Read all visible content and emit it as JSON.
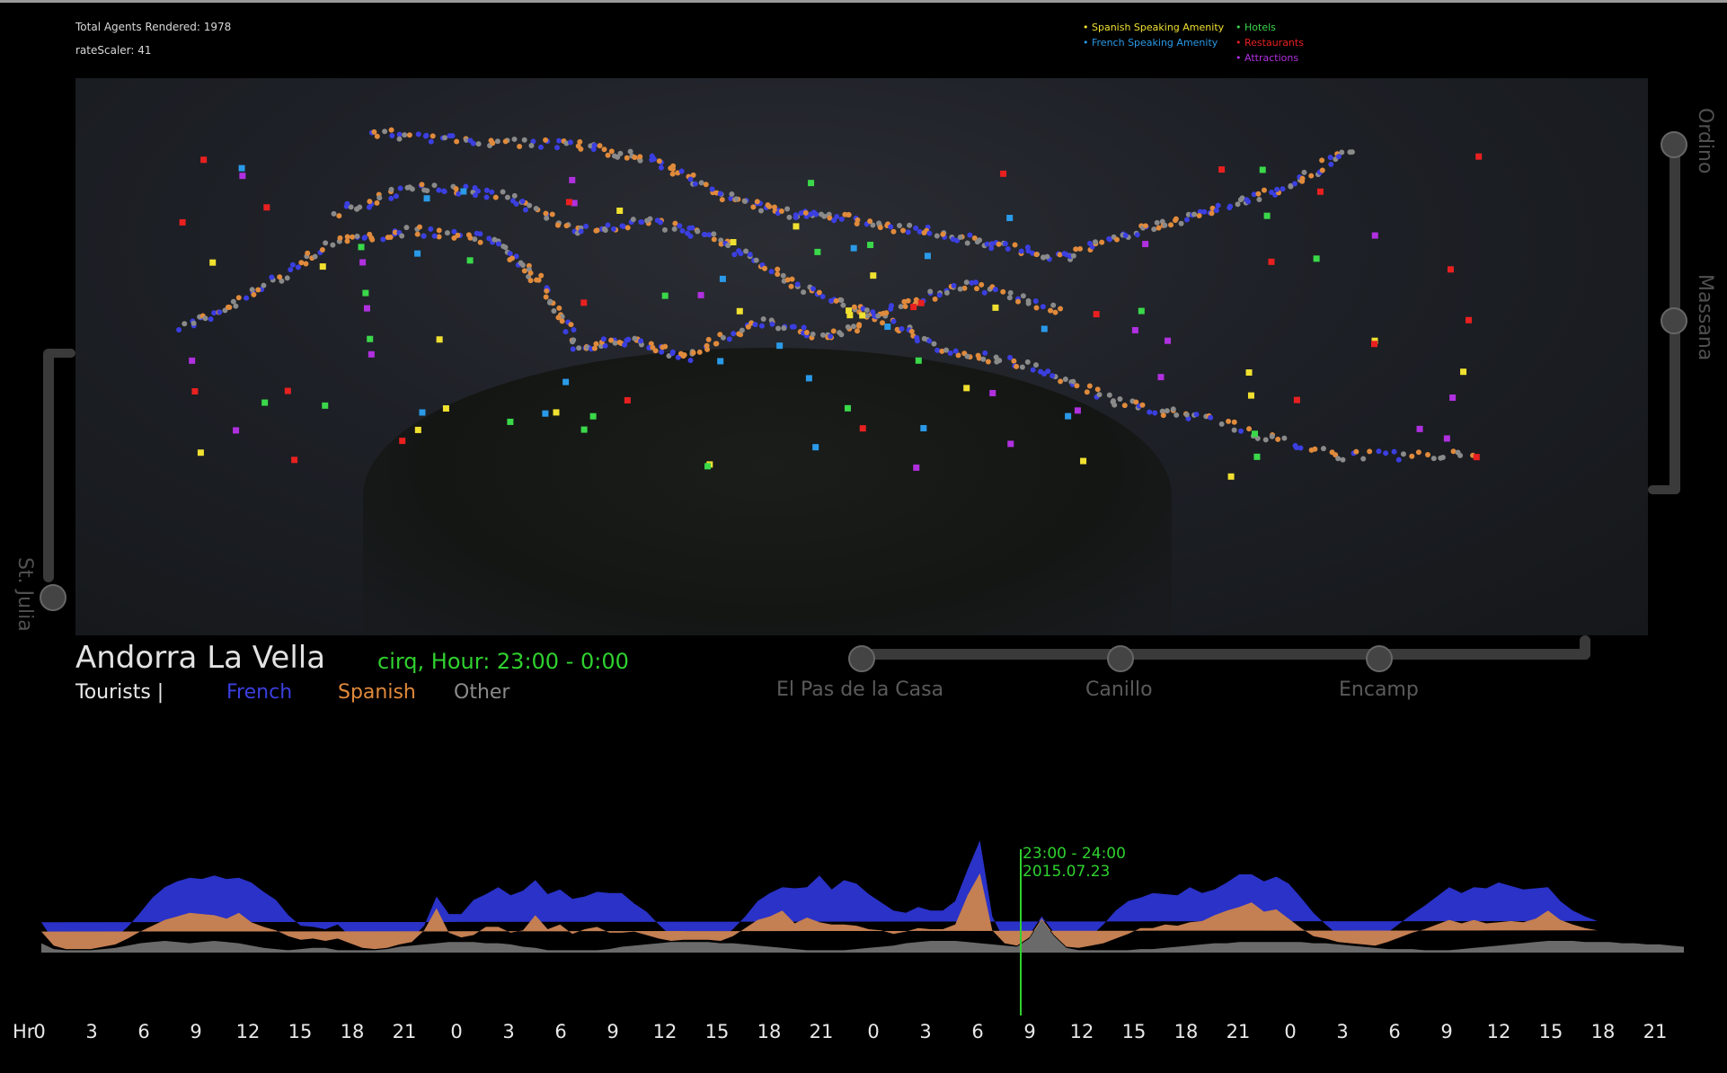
{
  "stats": {
    "agents": "Total Agents Rendered: 1978",
    "rate": "rateScaler: 41"
  },
  "legend": {
    "spanish_amenity": "Spanish Speaking Amenity",
    "french_amenity": "French Speaking Amenity",
    "hotels": "Hotels",
    "restaurants": "Restaurants",
    "attractions": "Attractions"
  },
  "colors": {
    "french": "#3b3fe0",
    "spanish": "#e08a3c",
    "other": "#8a8a8a",
    "spanish_amenity": "#f0e030",
    "french_amenity": "#2a9ae8",
    "hotels": "#3ad84a",
    "restaurants": "#e82020",
    "attractions": "#b030e0",
    "hour_green": "#2fd12f"
  },
  "place": {
    "title": "Andorra La Vella",
    "hour": "cirq, Hour: 23:00 - 0:00"
  },
  "tourists": {
    "label": "Tourists |",
    "french": "French",
    "spanish": "Spanish",
    "other": "Other"
  },
  "towns": {
    "pas": "El Pas de la Casa",
    "canillo": "Canillo",
    "encamp": "Encamp",
    "ordino": "Ordino",
    "massana": "Massana",
    "julia": "St. Julia"
  },
  "marker": {
    "hour": "23:00 - 24:00",
    "date": "2015.07.23"
  },
  "axis": {
    "prefix": "Hr",
    "ticks": [
      "0",
      "3",
      "6",
      "9",
      "12",
      "15",
      "18",
      "21",
      "0",
      "3",
      "6",
      "9",
      "12",
      "15",
      "18",
      "21",
      "0",
      "3",
      "6",
      "9",
      "12",
      "15",
      "18",
      "21",
      "0",
      "3",
      "6",
      "9",
      "12",
      "15",
      "18",
      "21"
    ]
  },
  "chart_data": {
    "type": "area",
    "title": "",
    "xlabel": "Hr",
    "x_tick_labels": [
      "0",
      "3",
      "6",
      "9",
      "12",
      "15",
      "18",
      "21",
      "0",
      "3",
      "6",
      "9",
      "12",
      "15",
      "18",
      "21",
      "0",
      "3",
      "6",
      "9",
      "12",
      "15",
      "18",
      "21",
      "0",
      "3",
      "6",
      "9",
      "12",
      "15",
      "18",
      "21"
    ],
    "stacked": true,
    "series": [
      {
        "name": "Other",
        "values": [
          8,
          3,
          2,
          2,
          2,
          3,
          4,
          6,
          8,
          9,
          10,
          9,
          8,
          9,
          10,
          9,
          8,
          6,
          4,
          3,
          2,
          3,
          4,
          4,
          2,
          2,
          2,
          2,
          3,
          5,
          6,
          7,
          8,
          9,
          9,
          9,
          8,
          8,
          7,
          5,
          4,
          2,
          2,
          2,
          2,
          2,
          3,
          5,
          6,
          7,
          8,
          9,
          9,
          9,
          9,
          8,
          8,
          7,
          6,
          5,
          4,
          3,
          2,
          2,
          2,
          2,
          3,
          4,
          5,
          6,
          8,
          9,
          10,
          10,
          10,
          9,
          8,
          7,
          6,
          5,
          12,
          28,
          14,
          4,
          2,
          2,
          2,
          2,
          2,
          3,
          3,
          4,
          5,
          6,
          7,
          8,
          8,
          9,
          9,
          9,
          9,
          9,
          9,
          8,
          8,
          7,
          6,
          5,
          4,
          3,
          3,
          3,
          2,
          2,
          2,
          3,
          4,
          5,
          6,
          7,
          8,
          9,
          10,
          10,
          10,
          9,
          9,
          9,
          8,
          8,
          7,
          7,
          6,
          5
        ]
      },
      {
        "name": "Spanish",
        "values": [
          10,
          3,
          1,
          1,
          1,
          2,
          3,
          6,
          10,
          14,
          18,
          22,
          26,
          24,
          22,
          20,
          26,
          20,
          18,
          16,
          12,
          8,
          8,
          6,
          10,
          6,
          2,
          1,
          1,
          2,
          3,
          12,
          30,
          8,
          4,
          6,
          14,
          14,
          10,
          14,
          28,
          18,
          22,
          14,
          18,
          20,
          14,
          12,
          12,
          8,
          4,
          1,
          2,
          2,
          2,
          2,
          6,
          14,
          22,
          26,
          32,
          22,
          28,
          24,
          22,
          22,
          20,
          16,
          14,
          10,
          10,
          12,
          10,
          10,
          14,
          40,
          60,
          12,
          2,
          1,
          1,
          1,
          1,
          1,
          2,
          4,
          6,
          10,
          14,
          18,
          18,
          20,
          18,
          20,
          20,
          24,
          28,
          30,
          34,
          26,
          28,
          20,
          12,
          6,
          4,
          2,
          2,
          2,
          2,
          6,
          10,
          14,
          18,
          22,
          26,
          22,
          24,
          20,
          20,
          20,
          18,
          20,
          26,
          18,
          14,
          12,
          10
        ]
      },
      {
        "name": "French",
        "values": [
          8,
          4,
          2,
          2,
          2,
          3,
          6,
          10,
          16,
          24,
          28,
          30,
          30,
          30,
          34,
          34,
          30,
          34,
          30,
          26,
          18,
          12,
          10,
          10,
          12,
          6,
          2,
          1,
          1,
          2,
          3,
          4,
          10,
          16,
          20,
          30,
          28,
          34,
          32,
          34,
          30,
          30,
          30,
          30,
          28,
          30,
          34,
          34,
          24,
          20,
          12,
          4,
          2,
          2,
          2,
          2,
          6,
          10,
          16,
          20,
          20,
          30,
          26,
          40,
          30,
          38,
          36,
          30,
          24,
          20,
          16,
          18,
          16,
          16,
          20,
          22,
          28,
          12,
          2,
          2,
          2,
          2,
          2,
          2,
          4,
          8,
          16,
          24,
          28,
          26,
          30,
          26,
          26,
          30,
          24,
          22,
          24,
          28,
          24,
          26,
          28,
          30,
          26,
          20,
          12,
          6,
          4,
          2,
          4,
          8,
          12,
          16,
          20,
          24,
          28,
          26,
          28,
          30,
          34,
          30,
          28,
          26,
          20,
          16,
          12,
          10,
          8
        ]
      }
    ]
  }
}
